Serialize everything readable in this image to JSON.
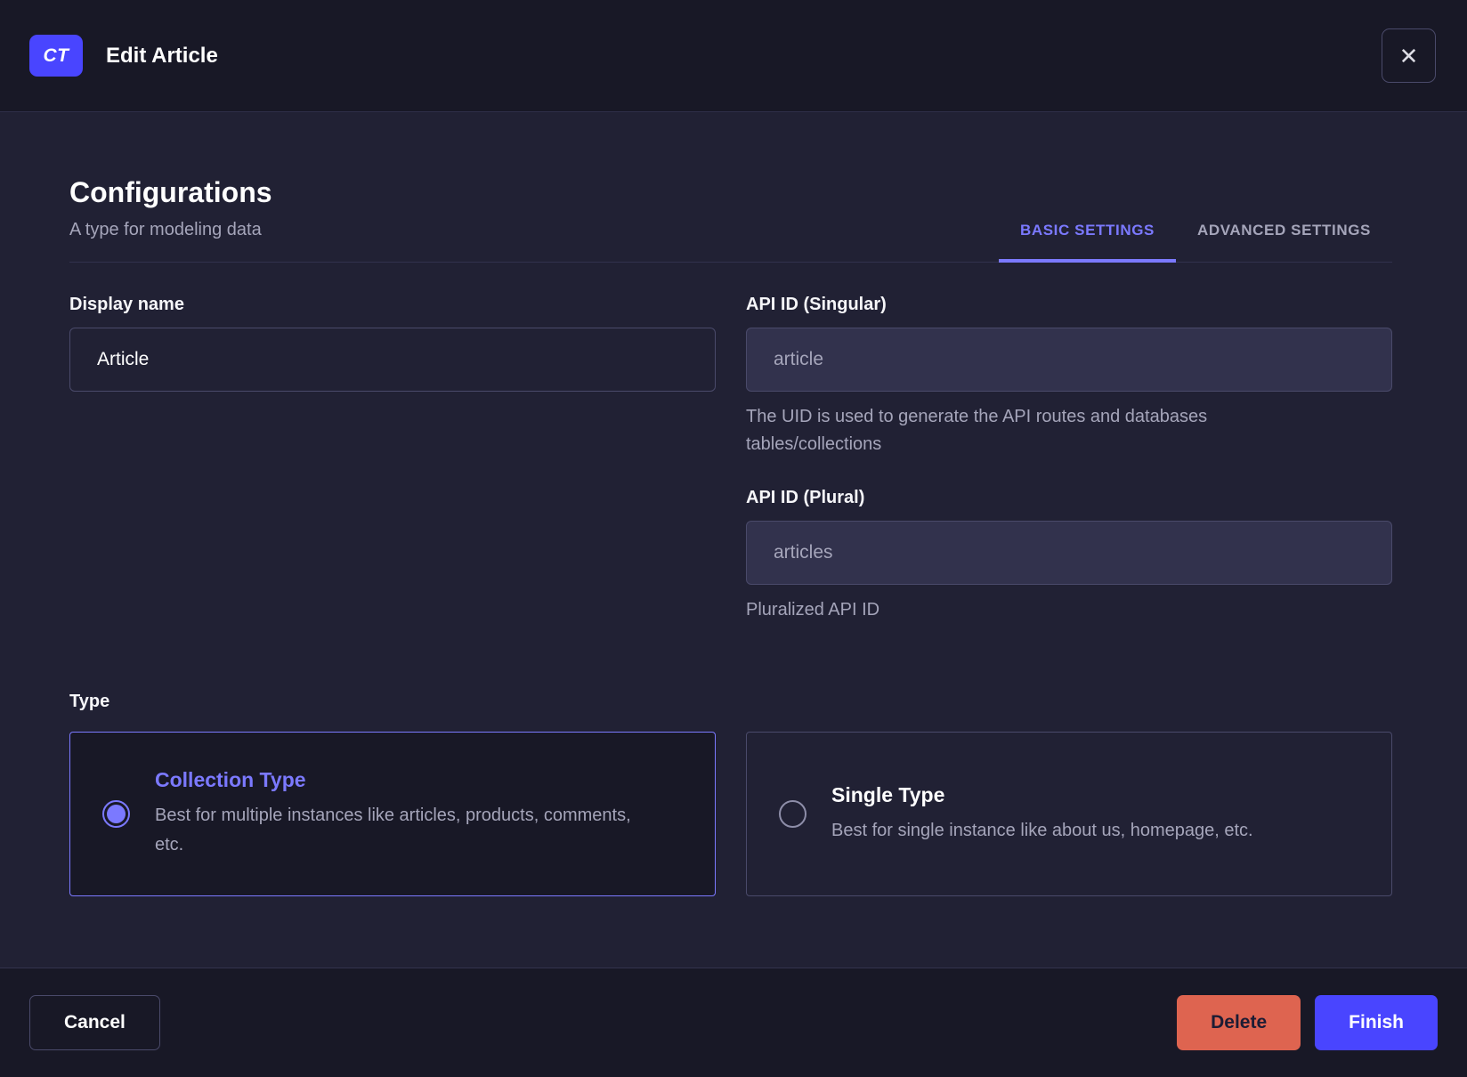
{
  "header": {
    "badge": "CT",
    "title": "Edit Article",
    "close_icon": "✕"
  },
  "section": {
    "title": "Configurations",
    "subtitle": "A type for modeling data"
  },
  "tabs": {
    "basic": {
      "label": "BASIC SETTINGS"
    },
    "advanced": {
      "label": "ADVANCED SETTINGS"
    }
  },
  "fields": {
    "display_name": {
      "label": "Display name",
      "value": "Article"
    },
    "api_id_singular": {
      "label": "API ID (Singular)",
      "value": "article",
      "hint": "The UID is used to generate the API routes and databases tables/collections"
    },
    "api_id_plural": {
      "label": "API ID (Plural)",
      "value": "articles",
      "hint": "Pluralized API ID"
    }
  },
  "type": {
    "label": "Type",
    "options": {
      "collection": {
        "title": "Collection Type",
        "description": "Best for multiple instances like articles, products, comments, etc.",
        "selected": "true"
      },
      "single": {
        "title": "Single Type",
        "description": "Best for single instance like about us, homepage, etc.",
        "selected": "false"
      }
    }
  },
  "footer": {
    "cancel_label": "Cancel",
    "delete_label": "Delete",
    "finish_label": "Finish"
  },
  "colors": {
    "accent": "#4945ff",
    "accent_light": "#7b79ff",
    "danger": "#de6450",
    "header_bg": "#181826",
    "body_bg": "#212134"
  }
}
